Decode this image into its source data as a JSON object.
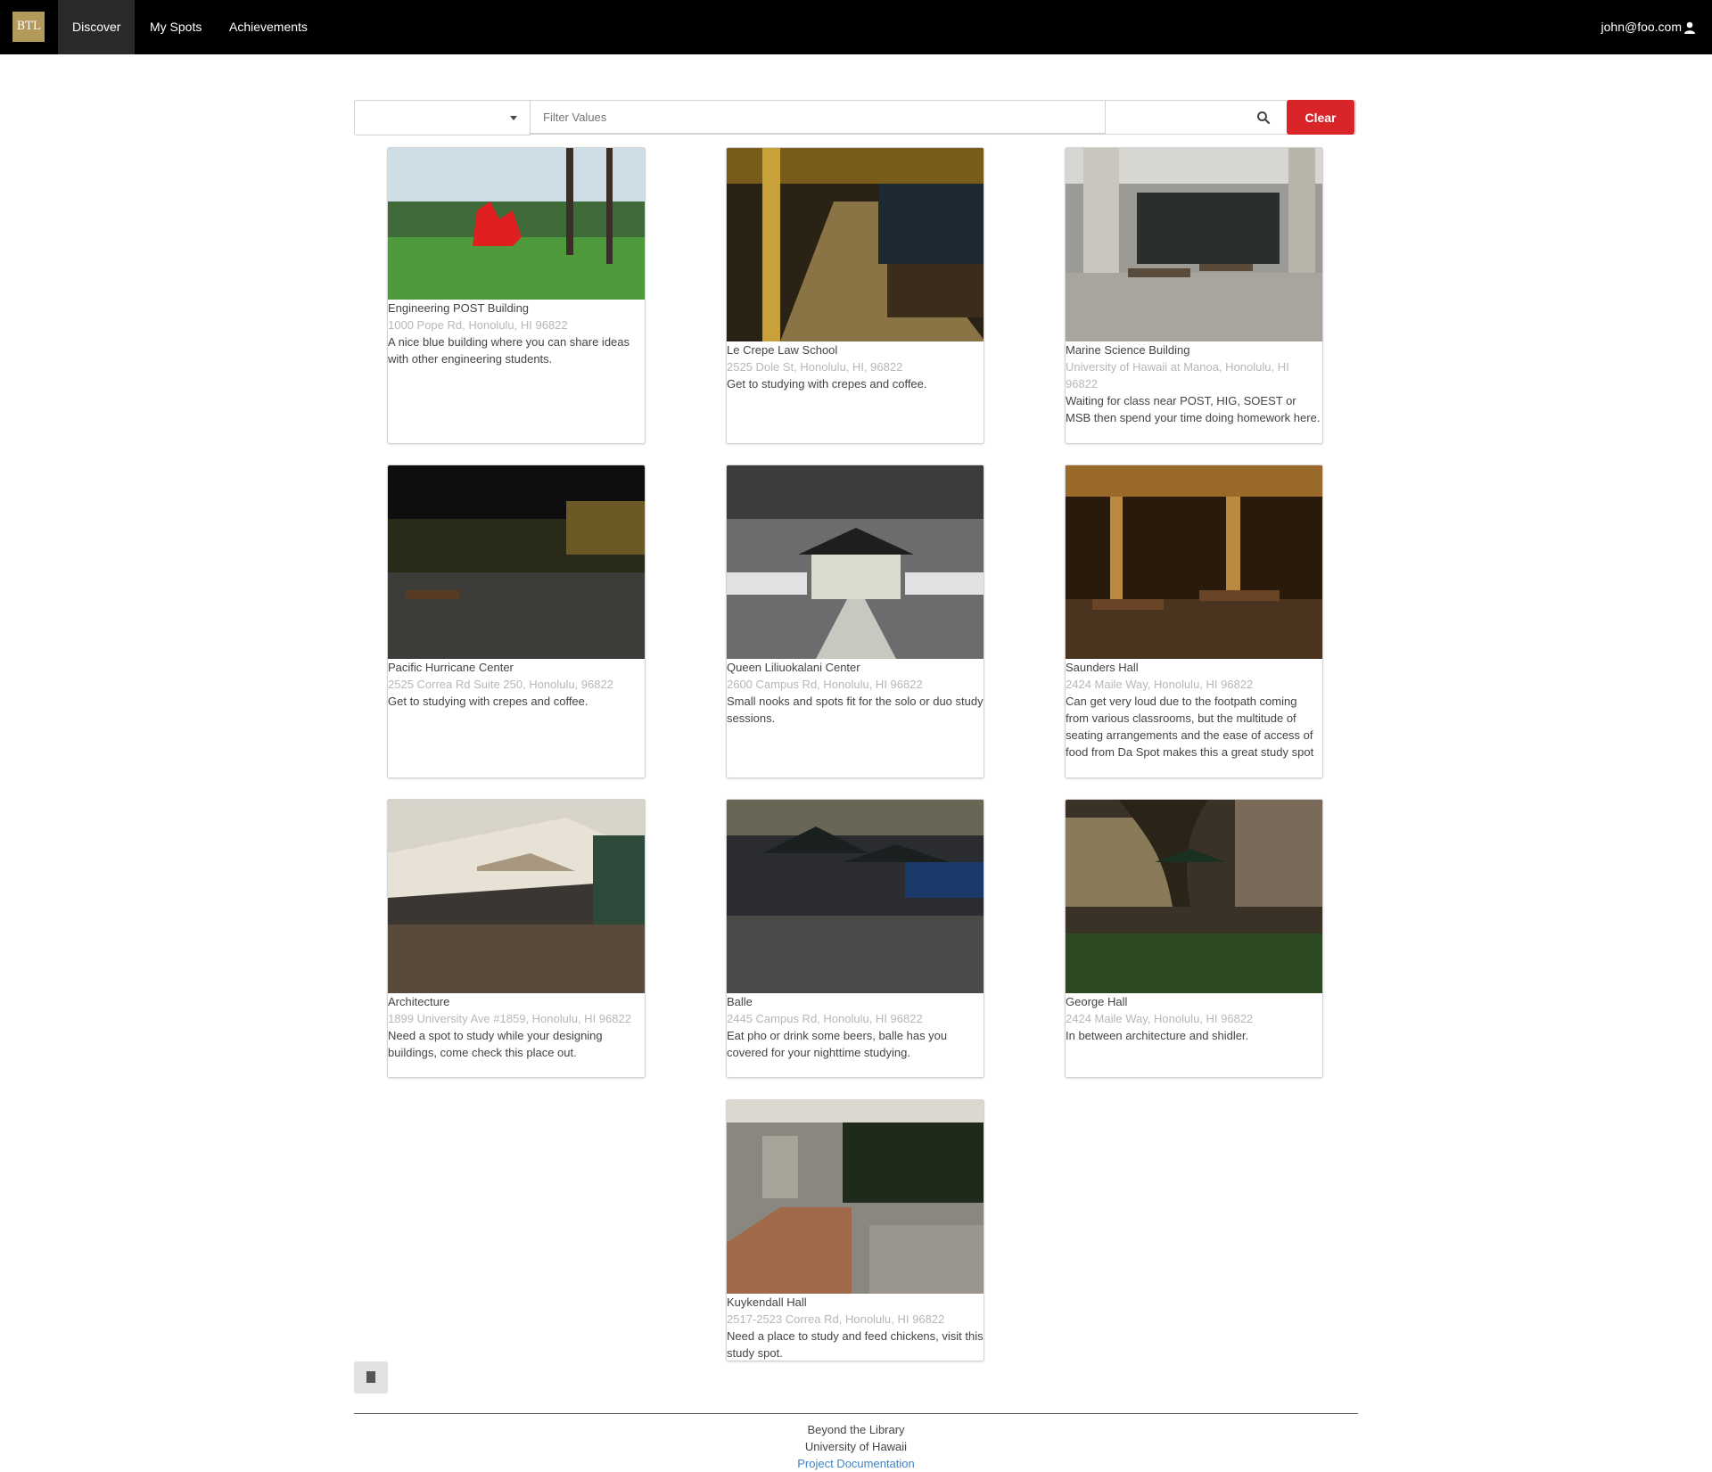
{
  "nav": {
    "logo": "BTL",
    "items": [
      "Discover",
      "My Spots",
      "Achievements"
    ],
    "active": "Discover",
    "user": "john@foo.com"
  },
  "filter": {
    "select_value": "",
    "placeholder": "Filter Values",
    "clear_label": "Clear"
  },
  "spots": [
    {
      "title": "Engineering POST Building",
      "address": "1000 Pope Rd, Honolulu, HI 96822",
      "description": "A nice blue building where you can share ideas with other engineering students."
    },
    {
      "title": "Le Crepe Law School",
      "address": "2525 Dole St, Honolulu, HI, 96822",
      "description": "Get to studying with crepes and coffee."
    },
    {
      "title": "Marine Science Building",
      "address": "University of Hawaii at Manoa, Honolulu, HI 96822",
      "description": "Waiting for class near POST, HIG, SOEST or MSB then spend your time doing homework here."
    },
    {
      "title": "Pacific Hurricane Center",
      "address": "2525 Correa Rd Suite 250, Honolulu, 96822",
      "description": "Get to studying with crepes and coffee."
    },
    {
      "title": "Queen Liliuokalani Center",
      "address": "2600 Campus Rd, Honolulu, HI 96822",
      "description": "Small nooks and spots fit for the solo or duo study sessions."
    },
    {
      "title": "Saunders Hall",
      "address": "2424 Maile Way, Honolulu, HI 96822",
      "description": "Can get very loud due to the footpath coming from various classrooms, but the multitude of seating arrangements and the ease of access of food from Da Spot makes this a great study spot"
    },
    {
      "title": "Architecture",
      "address": "1899 University Ave #1859, Honolulu, HI 96822",
      "description": "Need a spot to study while your designing buildings, come check this place out."
    },
    {
      "title": "Balle",
      "address": "2445 Campus Rd, Honolulu, HI 96822",
      "description": "Eat pho or drink some beers, balle has you covered for your nighttime studying."
    },
    {
      "title": "George Hall",
      "address": "2424 Maile Way, Honolulu, HI 96822",
      "description": "In between architecture and shidler."
    },
    {
      "title": "Kuykendall Hall",
      "address": "2517-2523 Correa Rd, Honolulu, HI 96822",
      "description": "Need a place to study and feed chickens, visit this study spot."
    }
  ],
  "footer": {
    "line1": "Beyond the Library",
    "line2": "University of Hawaii",
    "link": "Project Documentation"
  },
  "colors": {
    "navbar": "#000000",
    "logo_bg": "#b39a5b",
    "clear_button": "#d9242a",
    "link": "#4183c4"
  }
}
